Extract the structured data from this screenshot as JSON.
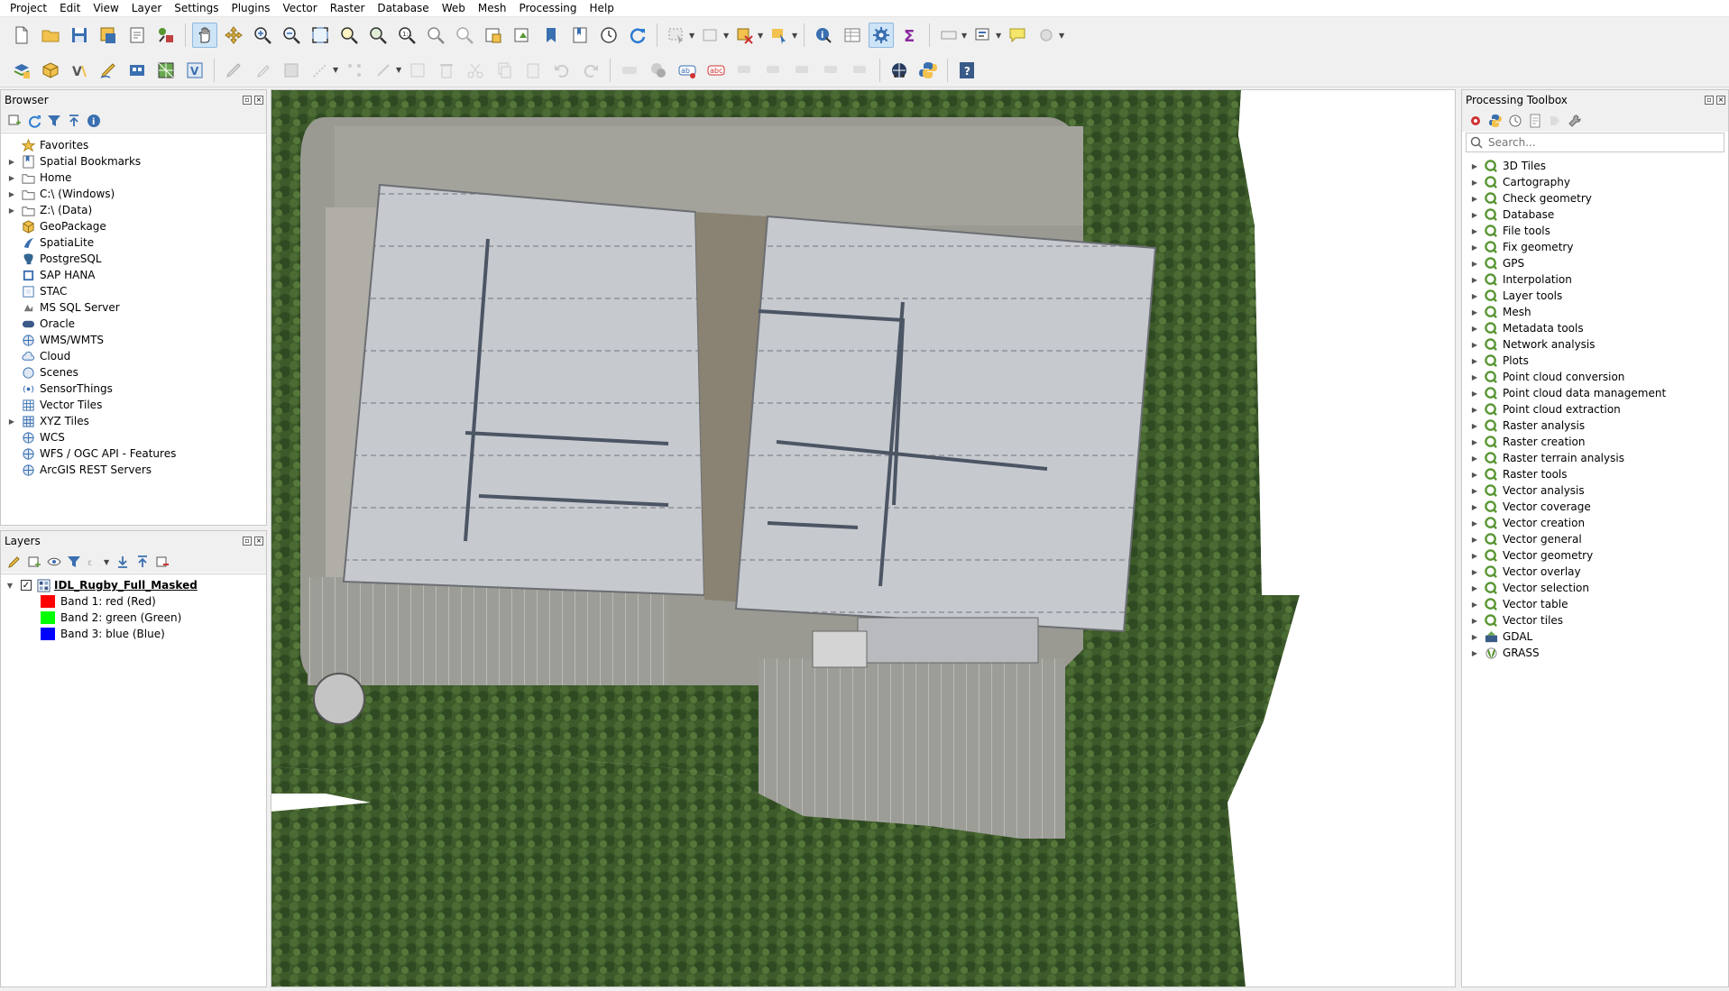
{
  "menu": [
    "Project",
    "Edit",
    "View",
    "Layer",
    "Settings",
    "Plugins",
    "Vector",
    "Raster",
    "Database",
    "Web",
    "Mesh",
    "Processing",
    "Help"
  ],
  "browser": {
    "title": "Browser",
    "items": [
      {
        "label": "Favorites",
        "icon": "star-icon",
        "expandable": false
      },
      {
        "label": "Spatial Bookmarks",
        "icon": "bookmark-icon",
        "expandable": true
      },
      {
        "label": "Home",
        "icon": "folder-icon",
        "expandable": true
      },
      {
        "label": "C:\\ (Windows)",
        "icon": "drive-icon",
        "expandable": true
      },
      {
        "label": "Z:\\ (Data)",
        "icon": "drive-icon",
        "expandable": true
      },
      {
        "label": "GeoPackage",
        "icon": "geopackage-icon",
        "expandable": false
      },
      {
        "label": "SpatiaLite",
        "icon": "spatialite-icon",
        "expandable": false
      },
      {
        "label": "PostgreSQL",
        "icon": "postgresql-icon",
        "expandable": false
      },
      {
        "label": "SAP HANA",
        "icon": "hana-icon",
        "expandable": false
      },
      {
        "label": "STAC",
        "icon": "stac-icon",
        "expandable": false
      },
      {
        "label": "MS SQL Server",
        "icon": "mssql-icon",
        "expandable": false
      },
      {
        "label": "Oracle",
        "icon": "oracle-icon",
        "expandable": false
      },
      {
        "label": "WMS/WMTS",
        "icon": "wms-icon",
        "expandable": false
      },
      {
        "label": "Cloud",
        "icon": "cloud-icon",
        "expandable": false
      },
      {
        "label": "Scenes",
        "icon": "scenes-icon",
        "expandable": false
      },
      {
        "label": "SensorThings",
        "icon": "sensor-icon",
        "expandable": false
      },
      {
        "label": "Vector Tiles",
        "icon": "vector-tiles-icon",
        "expandable": false
      },
      {
        "label": "XYZ Tiles",
        "icon": "xyz-tiles-icon",
        "expandable": true
      },
      {
        "label": "WCS",
        "icon": "wcs-icon",
        "expandable": false
      },
      {
        "label": "WFS / OGC API - Features",
        "icon": "wfs-icon",
        "expandable": false
      },
      {
        "label": "ArcGIS REST Servers",
        "icon": "arcgis-icon",
        "expandable": false
      }
    ]
  },
  "layers": {
    "title": "Layers",
    "layer_name": "IDL_Rugby_Full_Masked",
    "bands": [
      {
        "label": "Band 1: red (Red)",
        "color": "#ff0000"
      },
      {
        "label": "Band 2: green (Green)",
        "color": "#00ff00"
      },
      {
        "label": "Band 3: blue (Blue)",
        "color": "#0000ff"
      }
    ]
  },
  "toolbox": {
    "title": "Processing Toolbox",
    "search_placeholder": "Search...",
    "groups": [
      "3D Tiles",
      "Cartography",
      "Check geometry",
      "Database",
      "File tools",
      "Fix geometry",
      "GPS",
      "Interpolation",
      "Layer tools",
      "Mesh",
      "Metadata tools",
      "Network analysis",
      "Plots",
      "Point cloud conversion",
      "Point cloud data management",
      "Point cloud extraction",
      "Raster analysis",
      "Raster creation",
      "Raster terrain analysis",
      "Raster tools",
      "Vector analysis",
      "Vector coverage",
      "Vector creation",
      "Vector general",
      "Vector geometry",
      "Vector overlay",
      "Vector selection",
      "Vector table",
      "Vector tiles"
    ],
    "providers": [
      {
        "label": "GDAL",
        "icon": "gdal-icon"
      },
      {
        "label": "GRASS",
        "icon": "grass-icon"
      }
    ]
  },
  "colors": {
    "accent": "#3a6fb0",
    "qgis_green": "#589632",
    "roof": "#c9ccd0",
    "vegetation": "#3f5a2c",
    "pavement": "#9a9a93"
  }
}
